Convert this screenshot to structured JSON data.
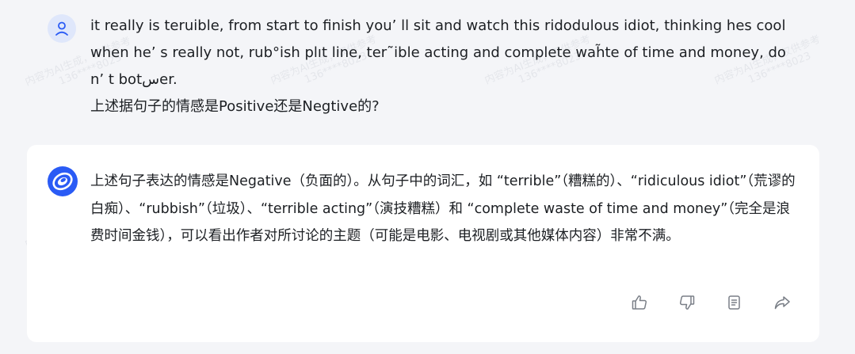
{
  "watermark": {
    "line1": "内容为AI生成，仅供参考",
    "line2": "136****8023"
  },
  "user_message": {
    "line1": "it really is teruible, from start to finish you’ ll sit and watch this ridodulous idiot, thinking hes cool",
    "line2": "when he’ s really not, rub°ish plıt line, ter˜ible acting and complete wah̃te of time and money, do",
    "line3": "n’ t botسer.",
    "line4": "上述据句子的情感是Positive还是Negtive的?"
  },
  "assistant_message": {
    "text": "上述句子表达的情感是Negative（负面的）。从句子中的词汇，如 “terrible”（糟糕的）、“ridiculous idiot”（荒谬的白痴）、“rubbish”（垃圾）、“terrible acting”（演技糟糕）和 “complete waste of time and money”（完全是浪费时间金钱），可以看出作者对所讨论的主题（可能是电影、电视剧或其他媒体内容）非常不满。"
  },
  "actions": {
    "like": "thumbs-up-icon",
    "dislike": "thumbs-down-icon",
    "copy": "copy-icon",
    "share": "share-icon"
  },
  "colors": {
    "background": "#f4f5f8",
    "card": "#ffffff",
    "accent": "#2a5bf5",
    "avatar_bg": "#dfe7fb",
    "icon": "#7a7f87"
  }
}
